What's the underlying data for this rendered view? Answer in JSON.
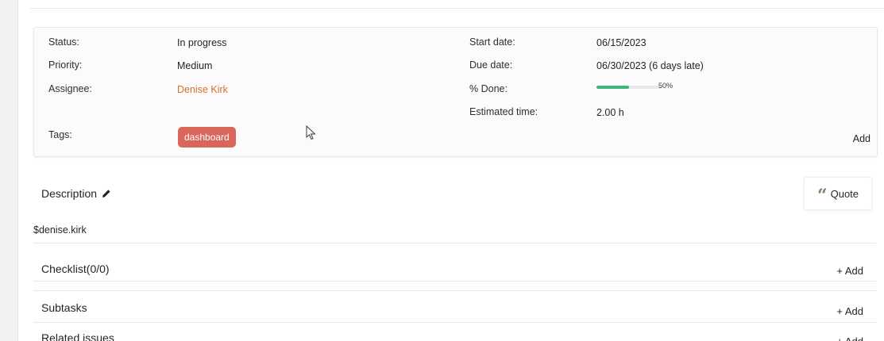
{
  "attributes": {
    "status_label": "Status:",
    "status_value": "In progress",
    "priority_label": "Priority:",
    "priority_value": "Medium",
    "assignee_label": "Assignee:",
    "assignee_value": "Denise Kirk",
    "tags_label": "Tags:",
    "tag": "dashboard",
    "start_label": "Start date:",
    "start_value": "06/15/2023",
    "due_label": "Due date:",
    "due_value": "06/30/2023 (6 days late)",
    "done_label": "% Done:",
    "done_percent": 50,
    "done_text": "50%",
    "estimated_label": "Estimated time:",
    "estimated_value": "2.00 h",
    "add_label": "Add"
  },
  "description": {
    "title": "Description",
    "body": "$denise.kirk",
    "quote_label": "Quote"
  },
  "sections": {
    "checklist_title": "Checklist(0/0)",
    "subtasks_title": "Subtasks",
    "related_title": "Related issues",
    "add_label": "+ Add"
  },
  "colors": {
    "assignee_link": "#d56f2c",
    "tag_bg": "#d9665b",
    "progress_fill": "#3fb57a"
  },
  "icons": [
    "pencil-icon",
    "quote-icon",
    "cursor-pointer-icon"
  ]
}
